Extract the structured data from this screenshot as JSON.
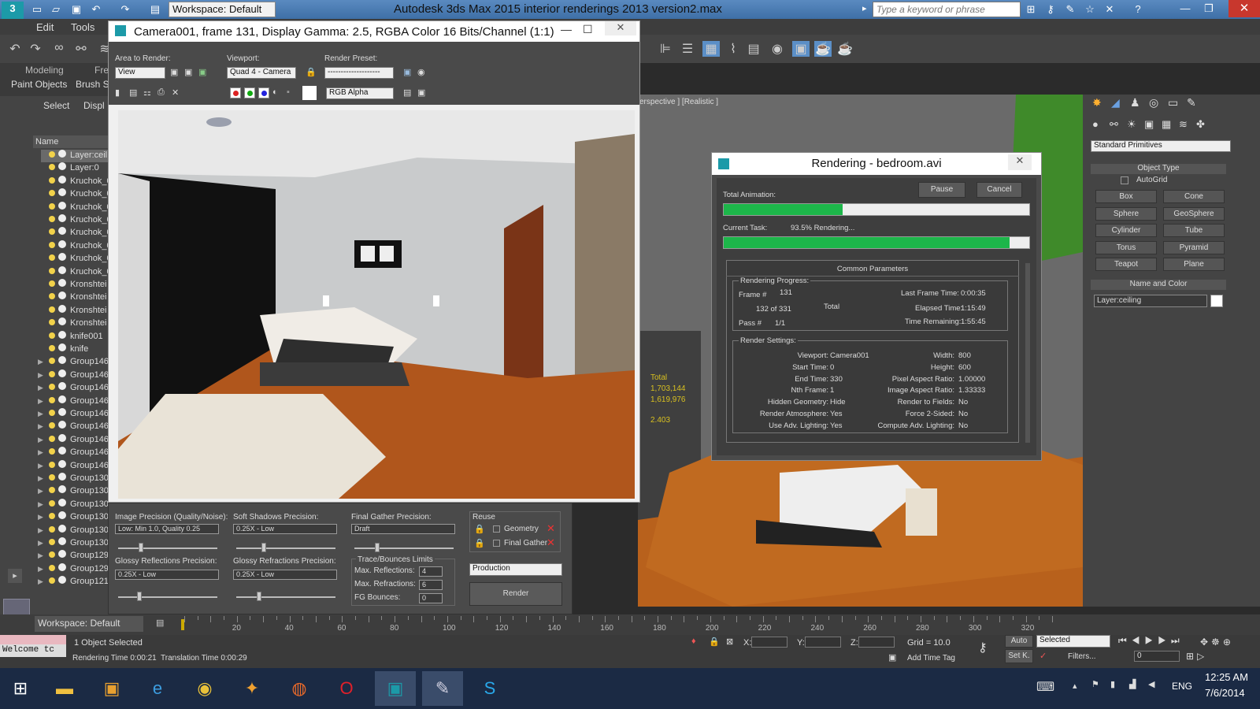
{
  "app": {
    "workspace": "Workspace: Default",
    "title": "Autodesk 3ds Max  2015    interior renderings 2013 version2.max",
    "search_placeholder": "Type a keyword or phrase"
  },
  "menu": [
    "Edit",
    "Tools"
  ],
  "ribbon": {
    "tab1": "Modeling",
    "tab2": "Fre",
    "sub1": "Paint Objects",
    "sub2": "Brush S"
  },
  "explorer": {
    "select": "Select",
    "display": "Displ",
    "column": "Name",
    "rows": [
      "Layer:ceil",
      "Layer:0",
      "Kruchok_0",
      "Kruchok_0",
      "Kruchok_0",
      "Kruchok_0",
      "Kruchok_0",
      "Kruchok_0",
      "Kruchok_0",
      "Kruchok_0",
      "Kronshtei",
      "Kronshtei",
      "Kronshtei",
      "Kronshtei",
      "knife001",
      "knife",
      "Group146",
      "Group146",
      "Group146",
      "Group146",
      "Group146",
      "Group146",
      "Group146",
      "Group146",
      "Group146",
      "Group130",
      "Group130",
      "Group130",
      "Group130",
      "Group130",
      "Group130",
      "Group129",
      "Group129",
      "Group121"
    ]
  },
  "viewport": {
    "label": "erspective ] [Realistic ]",
    "nums": [
      "Total",
      "1,703,144",
      "1,619,976",
      "2.403"
    ]
  },
  "command_panel": {
    "category": "Standard Primitives",
    "object_type": "Object Type",
    "autogrid": "AutoGrid",
    "primitives": [
      "Box",
      "Cone",
      "Sphere",
      "GeoSphere",
      "Cylinder",
      "Tube",
      "Torus",
      "Pyramid",
      "Teapot",
      "Plane"
    ],
    "name_color": "Name and Color",
    "name_value": "Layer:ceiling"
  },
  "render_frame": {
    "title": "Camera001, frame 131, Display Gamma: 2.5, RGBA Color 16 Bits/Channel (1:1)",
    "area_label": "Area to Render:",
    "area_value": "View",
    "viewport_label": "Viewport:",
    "viewport_value": "Quad 4 - Camera",
    "preset_label": "Render Preset:",
    "preset_value": "--------------------",
    "channel_value": "RGB Alpha",
    "image_precision_label": "Image Precision (Quality/Noise):",
    "image_precision_value": "Low: Min 1.0, Quality 0.25",
    "soft_shadows_label": "Soft Shadows Precision:",
    "soft_shadows_value": "0.25X - Low",
    "fg_precision_label": "Final Gather Precision:",
    "fg_precision_value": "Draft",
    "glossy_refl_label": "Glossy Reflections Precision:",
    "glossy_refl_value": "0.25X - Low",
    "glossy_refr_label": "Glossy Refractions Precision:",
    "glossy_refr_value": "0.25X - Low",
    "reuse_label": "Reuse",
    "geometry": "Geometry",
    "final_gather": "Final Gather",
    "trace_label": "Trace/Bounces Limits",
    "max_refl_label": "Max. Reflections:",
    "max_refl": "4",
    "max_refr_label": "Max. Refractions:",
    "max_refr": "6",
    "fg_bounces_label": "FG Bounces:",
    "fg_bounces": "0",
    "mode": "Production",
    "render_btn": "Render"
  },
  "rendering_dialog": {
    "title": "Rendering - bedroom.avi",
    "total_animation": "Total Animation:",
    "pause": "Pause",
    "cancel": "Cancel",
    "current_task": "Current Task:",
    "task_status": "93.5% Rendering...",
    "total_progress": 0.39,
    "task_progress": 0.935,
    "common_params": "Common Parameters",
    "progress_head": "Rendering Progress:",
    "frame_label": "Frame #",
    "frame": "131",
    "count": "132  of  331",
    "total": "Total",
    "pass_label": "Pass #",
    "pass": "1/1",
    "last_frame_label": "Last Frame Time:",
    "last_frame": "0:00:35",
    "elapsed_label": "Elapsed Time:",
    "elapsed": "1:15:49",
    "remaining_label": "Time Remaining:",
    "remaining": "1:55:45",
    "settings_head": "Render Settings:",
    "settings_left": [
      [
        "Viewport:",
        "Camera001"
      ],
      [
        "Start Time:",
        "0"
      ],
      [
        "End Time:",
        "330"
      ],
      [
        "Nth Frame:",
        "1"
      ],
      [
        "Hidden Geometry:",
        "Hide"
      ],
      [
        "Render Atmosphere:",
        "Yes"
      ],
      [
        "Use Adv. Lighting:",
        "Yes"
      ]
    ],
    "settings_right": [
      [
        "Width:",
        "800"
      ],
      [
        "Height:",
        "600"
      ],
      [
        "Pixel Aspect Ratio:",
        "1.00000"
      ],
      [
        "Image Aspect Ratio:",
        "1.33333"
      ],
      [
        "Render to Fields:",
        "No"
      ],
      [
        "Force 2-Sided:",
        "No"
      ],
      [
        "Compute Adv. Lighting:",
        "No"
      ]
    ]
  },
  "timeline": {
    "ticks": [
      "20",
      "40",
      "60",
      "80",
      "100",
      "120",
      "140",
      "160",
      "180",
      "200",
      "220",
      "240",
      "260",
      "280",
      "300",
      "320"
    ]
  },
  "status": {
    "workspace": "Workspace: Default",
    "selected": "1 Object Selected",
    "render_time": "Rendering Time  0:00:21",
    "translation_time": "Translation Time  0:00:29",
    "maxscript": "Welcome tc",
    "x": "X:",
    "y": "Y:",
    "z": "Z:",
    "grid": "Grid = 10.0",
    "add_time_tag": "Add Time Tag",
    "auto": "Auto",
    "setk": "Set K.",
    "selected_dd": "Selected",
    "filters": "Filters...",
    "frame_field": "0"
  },
  "taskbar": {
    "lang": "ENG",
    "time": "12:25 AM",
    "date": "7/6/2014"
  }
}
